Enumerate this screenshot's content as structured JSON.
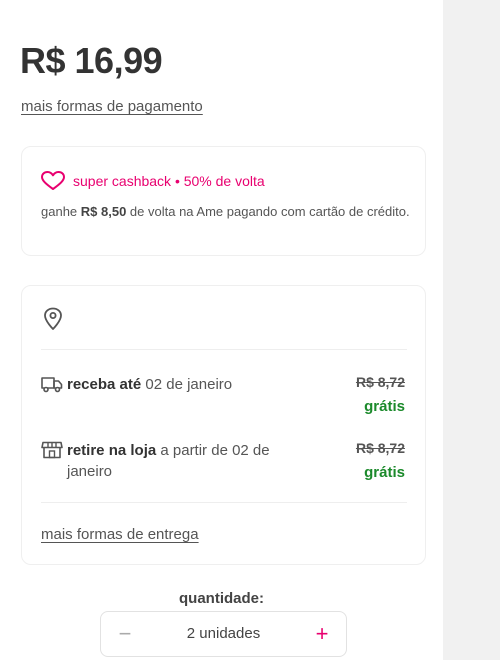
{
  "price": "R$ 16,99",
  "payment_link": "mais formas de pagamento",
  "cashback": {
    "title": "super cashback • 50% de volta",
    "desc_prefix": "ganhe ",
    "amount": "R$ 8,50",
    "desc_suffix": " de volta na Ame pagando com cartão de crédito.",
    "accent_color": "#e8006f"
  },
  "delivery": {
    "options": [
      {
        "icon": "truck-icon",
        "label_bold": "receba até",
        "label_rest": " 02 de janeiro",
        "old_price": "R$ 8,72",
        "price": "grátis"
      },
      {
        "icon": "store-icon",
        "label_bold": "retire na loja",
        "label_rest": " a partir de 02 de janeiro",
        "old_price": "R$ 8,72",
        "price": "grátis"
      }
    ],
    "more_link": "mais formas de entrega",
    "free_color": "#1b8a2b"
  },
  "quantity": {
    "label": "quantidade:",
    "value": "2 unidades",
    "minus": "−",
    "plus": "+"
  }
}
